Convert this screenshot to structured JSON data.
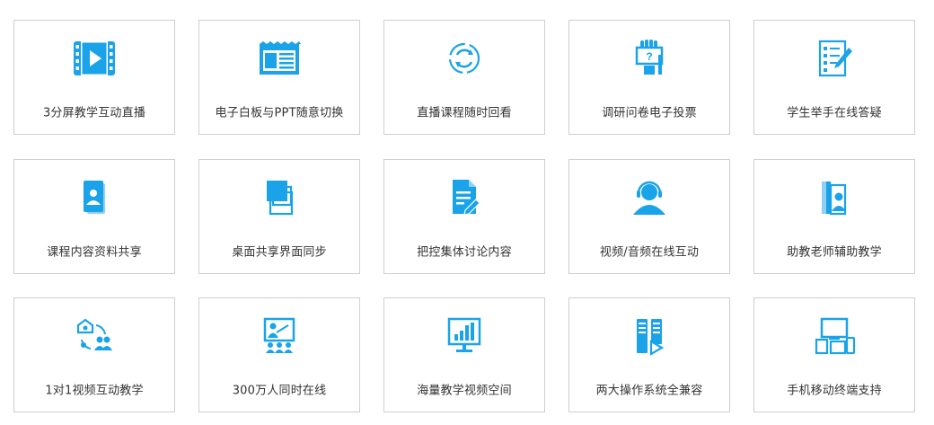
{
  "accent_color": "#1aa3e8",
  "features": [
    {
      "label": "3分屏教学互动直播",
      "icon": "video-play-icon"
    },
    {
      "label": "电子白板与PPT随意切换",
      "icon": "whiteboard-icon"
    },
    {
      "label": "直播课程随时回看",
      "icon": "replay-icon"
    },
    {
      "label": "调研问卷电子投票",
      "icon": "vote-icon"
    },
    {
      "label": "学生举手在线答疑",
      "icon": "checklist-icon"
    },
    {
      "label": "课程内容资料共享",
      "icon": "contact-card-icon"
    },
    {
      "label": "桌面共享界面同步",
      "icon": "screen-share-icon"
    },
    {
      "label": "把控集体讨论内容",
      "icon": "document-edit-icon"
    },
    {
      "label": "视频/音频在线互动",
      "icon": "headset-user-icon"
    },
    {
      "label": "助教老师辅助教学",
      "icon": "assistant-teacher-icon"
    },
    {
      "label": "1对1视频互动教学",
      "icon": "one-on-one-icon"
    },
    {
      "label": "300万人同时在线",
      "icon": "classroom-icon"
    },
    {
      "label": "海量教学视频空间",
      "icon": "monitor-chart-icon"
    },
    {
      "label": "两大操作系统全兼容",
      "icon": "server-play-icon"
    },
    {
      "label": "手机移动终端支持",
      "icon": "devices-icon"
    }
  ]
}
